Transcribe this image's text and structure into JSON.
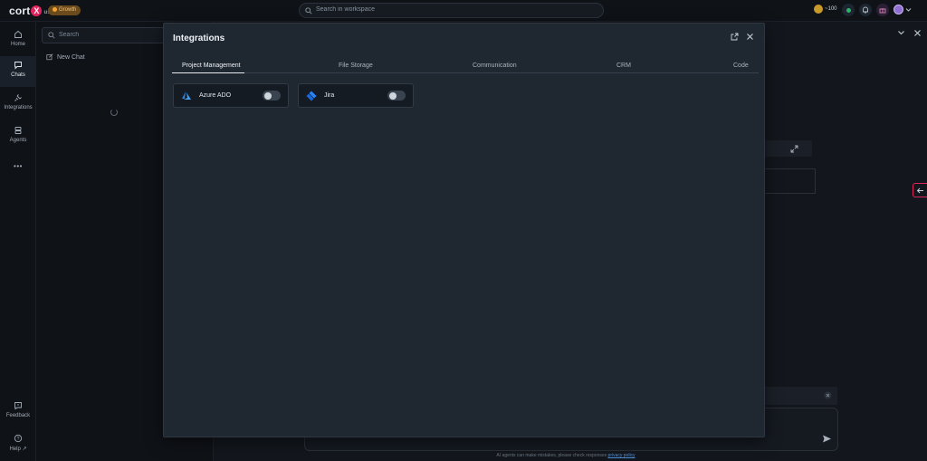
{
  "topbar": {
    "logo_text": "cort",
    "logo_mark": "X",
    "logo_sub": "us",
    "badge": "Growth",
    "search_placeholder": "Search in workspace",
    "credits": "~100"
  },
  "nav": {
    "items": [
      {
        "label": "Home",
        "icon": "home-icon"
      },
      {
        "label": "Chats",
        "icon": "chat-icon"
      },
      {
        "label": "Integrations",
        "icon": "plug-icon"
      },
      {
        "label": "Agents",
        "icon": "agent-icon"
      }
    ],
    "more": "•••",
    "feedback": "Feedback",
    "help": "Help"
  },
  "chatlist": {
    "search_placeholder": "Search",
    "new_chat": "New Chat"
  },
  "footer": {
    "disclaimer": "AI agents can make mistakes, please check responses",
    "link": "privacy policy"
  },
  "modal": {
    "title": "Integrations",
    "tabs": [
      {
        "label": "Project Management",
        "active": true
      },
      {
        "label": "File Storage",
        "active": false
      },
      {
        "label": "Communication",
        "active": false
      },
      {
        "label": "CRM",
        "active": false
      },
      {
        "label": "Code",
        "active": false
      }
    ],
    "integrations": [
      {
        "name": "Azure ADO",
        "enabled": false,
        "brand_color": "#2b7fd4"
      },
      {
        "name": "Jira",
        "enabled": false,
        "brand_color": "#2684ff"
      }
    ]
  }
}
